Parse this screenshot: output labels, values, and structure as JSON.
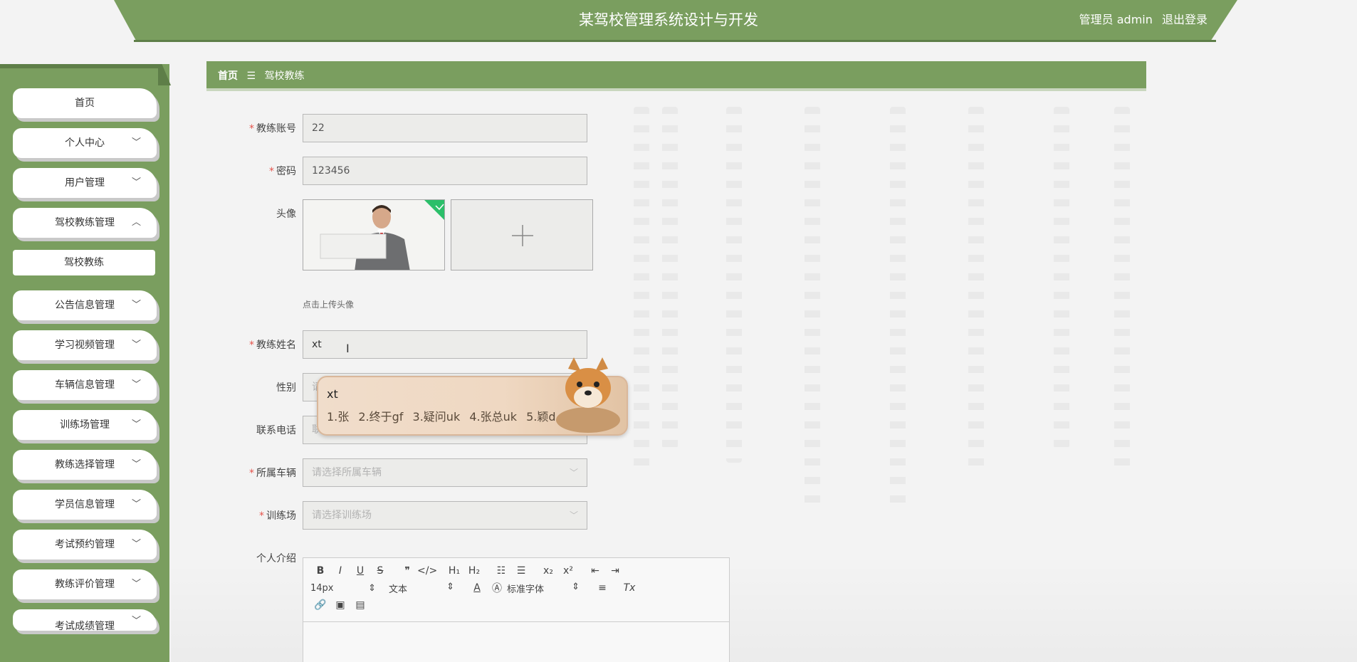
{
  "app": {
    "title": "某驾校管理系统设计与开发",
    "user_label": "管理员 admin",
    "logout_label": "退出登录"
  },
  "sidebar": {
    "items": [
      {
        "label": "首页",
        "expandable": false
      },
      {
        "label": "个人中心",
        "expandable": true
      },
      {
        "label": "用户管理",
        "expandable": true
      },
      {
        "label": "驾校教练管理",
        "expandable": true,
        "expanded": true
      },
      {
        "label": "公告信息管理",
        "expandable": true
      },
      {
        "label": "学习视频管理",
        "expandable": true
      },
      {
        "label": "车辆信息管理",
        "expandable": true
      },
      {
        "label": "训练场管理",
        "expandable": true
      },
      {
        "label": "教练选择管理",
        "expandable": true
      },
      {
        "label": "学员信息管理",
        "expandable": true
      },
      {
        "label": "考试预约管理",
        "expandable": true
      },
      {
        "label": "教练评价管理",
        "expandable": true
      },
      {
        "label": "考试成绩管理",
        "expandable": true
      }
    ],
    "sub_item": "驾校教练"
  },
  "breadcrumb": {
    "home": "首页",
    "separator": "☰",
    "current": "驾校教练"
  },
  "form": {
    "account": {
      "label": "教练账号",
      "value": "22",
      "required": true
    },
    "password": {
      "label": "密码",
      "value": "123456",
      "required": true
    },
    "avatar": {
      "label": "头像",
      "hint": "点击上传头像"
    },
    "name": {
      "label": "教练姓名",
      "value": "xt",
      "required": true
    },
    "gender": {
      "label": "性别",
      "placeholder": "请"
    },
    "phone": {
      "label": "联系电话",
      "placeholder": "联"
    },
    "vehicle": {
      "label": "所属车辆",
      "placeholder": "请选择所属车辆",
      "required": true
    },
    "field": {
      "label": "训练场",
      "placeholder": "请选择训练场",
      "required": true
    },
    "intro": {
      "label": "个人介绍"
    }
  },
  "ime": {
    "composition": "xt",
    "candidates": [
      "1.张",
      "2.终于gf",
      "3.疑问uk",
      "4.张总uk",
      "5.颖d"
    ]
  },
  "editor": {
    "font_size": "14px",
    "block": "文本",
    "font_family": "标准字体"
  },
  "colors": {
    "primary": "#7a9e5f",
    "primary_dark": "#5e7e48",
    "required": "#e5534b"
  }
}
